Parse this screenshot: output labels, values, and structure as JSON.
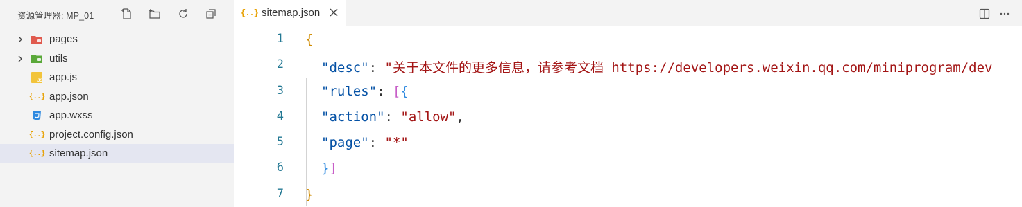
{
  "sidebar": {
    "title": "资源管理器: MP_01",
    "actions": [
      {
        "name": "new-file-icon"
      },
      {
        "name": "new-folder-icon"
      },
      {
        "name": "refresh-icon"
      },
      {
        "name": "collapse-all-icon"
      }
    ],
    "items": [
      {
        "label": "pages",
        "type": "folder",
        "icon": "folder-pages-icon",
        "color": "#e05a4e"
      },
      {
        "label": "utils",
        "type": "folder",
        "icon": "folder-utils-icon",
        "color": "#5aa839"
      },
      {
        "label": "app.js",
        "type": "file",
        "icon": "js-file-icon",
        "color": "#f2c43b"
      },
      {
        "label": "app.json",
        "type": "file",
        "icon": "json-file-icon",
        "color": "#e7a000"
      },
      {
        "label": "app.wxss",
        "type": "file",
        "icon": "css-file-icon",
        "color": "#2f8ae0"
      },
      {
        "label": "project.config.json",
        "type": "file",
        "icon": "json-file-icon",
        "color": "#e7a000"
      },
      {
        "label": "sitemap.json",
        "type": "file",
        "icon": "json-file-icon",
        "color": "#e7a000",
        "selected": true
      }
    ]
  },
  "editor": {
    "tab": {
      "label": "sitemap.json",
      "icon": "json-file-icon"
    },
    "toolbar": [
      {
        "name": "split-editor-icon"
      },
      {
        "name": "more-actions-icon"
      }
    ],
    "lines": [
      {
        "n": "1"
      },
      {
        "n": "2"
      },
      {
        "n": "3"
      },
      {
        "n": "4"
      },
      {
        "n": "5"
      },
      {
        "n": "6"
      },
      {
        "n": "7"
      }
    ],
    "code": {
      "open_brace": "{",
      "desc_key": "\"desc\"",
      "desc_value_text": "\"关于本文件的更多信息，请参考文档 ",
      "desc_value_url": "https://developers.weixin.qq.com/miniprogram/dev",
      "rules_key": "\"rules\"",
      "action_key": "\"action\"",
      "action_value": "\"allow\"",
      "page_key": "\"page\"",
      "page_value": "\"*\"",
      "close_brace": "}"
    }
  },
  "colors": {
    "sidebar_bg": "#f3f3f3",
    "selected_bg": "#e4e6f1",
    "line_number": "#237893",
    "json_key": "#0451a5",
    "json_string": "#a31515",
    "brace_level1": "#d08b00",
    "bracket_level2": "#c75ec7",
    "brace_level3": "#2f8ae0"
  }
}
